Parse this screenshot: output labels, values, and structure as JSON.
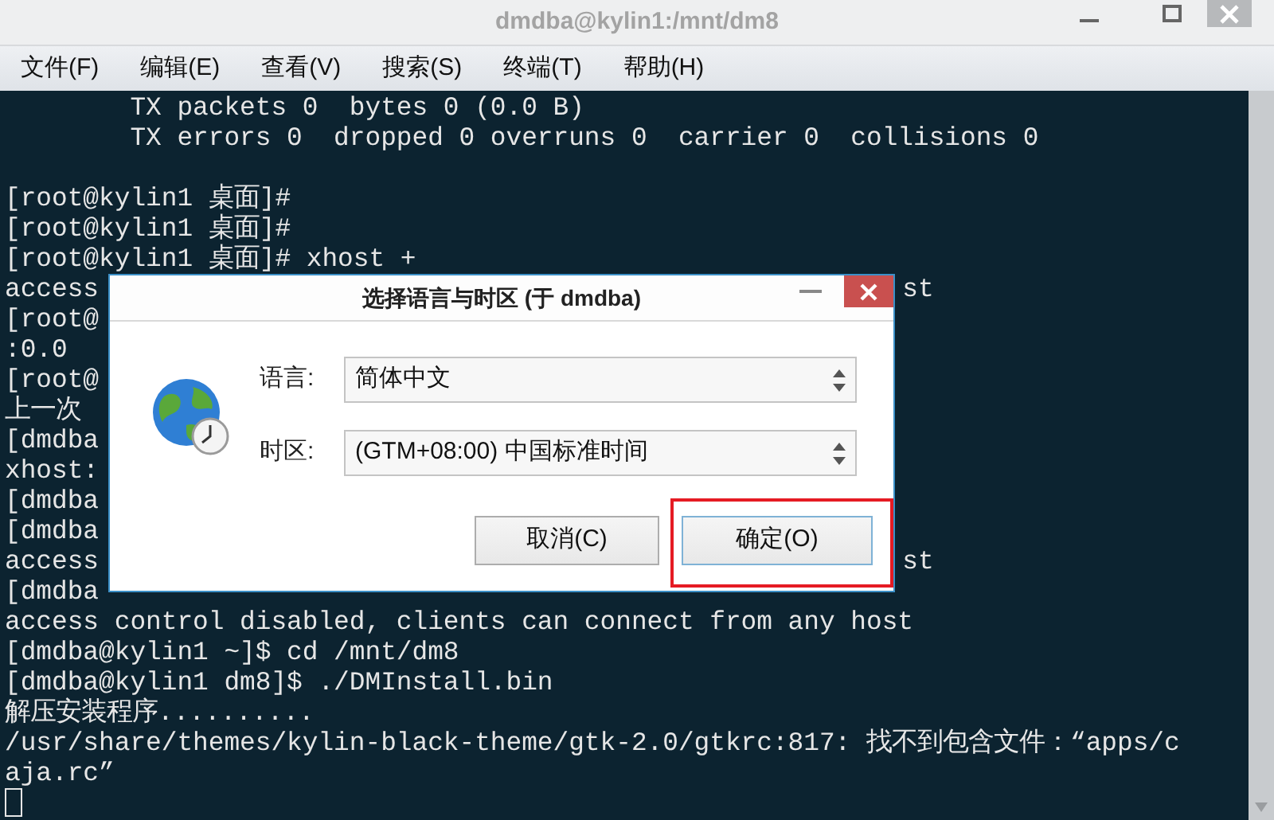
{
  "window": {
    "title": "dmdba@kylin1:/mnt/dm8"
  },
  "menu": [
    "文件(F)",
    "编辑(E)",
    "查看(V)",
    "搜索(S)",
    "终端(T)",
    "帮助(H)"
  ],
  "terminal": {
    "lines": [
      {
        "kind": "text",
        "text": "        TX packets 0  bytes 0 (0.0 B)"
      },
      {
        "kind": "text",
        "text": "        TX errors 0  dropped 0 overruns 0  carrier 0  collisions 0"
      },
      {
        "kind": "blank"
      },
      {
        "kind": "text",
        "text": "[root@kylin1 桌面]#"
      },
      {
        "kind": "text",
        "text": "[root@kylin1 桌面]#"
      },
      {
        "kind": "text",
        "text": "[root@kylin1 桌面]# xhost +"
      },
      {
        "kind": "text",
        "text": "access",
        "tail": "st"
      },
      {
        "kind": "text",
        "text": "[root@"
      },
      {
        "kind": "text",
        "text": ":0.0"
      },
      {
        "kind": "text",
        "text": "[root@"
      },
      {
        "kind": "text",
        "text": "上一次"
      },
      {
        "kind": "text",
        "text": "[dmdba"
      },
      {
        "kind": "text",
        "text": "xhost:"
      },
      {
        "kind": "text",
        "text": "[dmdba"
      },
      {
        "kind": "text",
        "text": "[dmdba"
      },
      {
        "kind": "text",
        "text": "access",
        "tail": "st"
      },
      {
        "kind": "text",
        "text": "[dmdba"
      },
      {
        "kind": "text",
        "text": "access control disabled, clients can connect from any host"
      },
      {
        "kind": "text",
        "text": "[dmdba@kylin1 ~]$ cd /mnt/dm8"
      },
      {
        "kind": "text",
        "text": "[dmdba@kylin1 dm8]$ ./DMInstall.bin"
      },
      {
        "kind": "text",
        "text": "解压安装程序.........."
      },
      {
        "kind": "text",
        "text": "/usr/share/themes/kylin-black-theme/gtk-2.0/gtkrc:817: 找不到包含文件：“apps/c"
      },
      {
        "kind": "text",
        "text": "aja.rc”"
      }
    ],
    "cursor": true
  },
  "dialog": {
    "title": "选择语言与时区 (于 dmdba)",
    "fields": [
      {
        "label": "语言:",
        "value": "简体中文"
      },
      {
        "label": "时区:",
        "value": "(GTM+08:00) 中国标准时间"
      }
    ],
    "buttons": [
      {
        "label": "取消(C)",
        "highlighted": false
      },
      {
        "label": "确定(O)",
        "highlighted": true
      }
    ]
  }
}
